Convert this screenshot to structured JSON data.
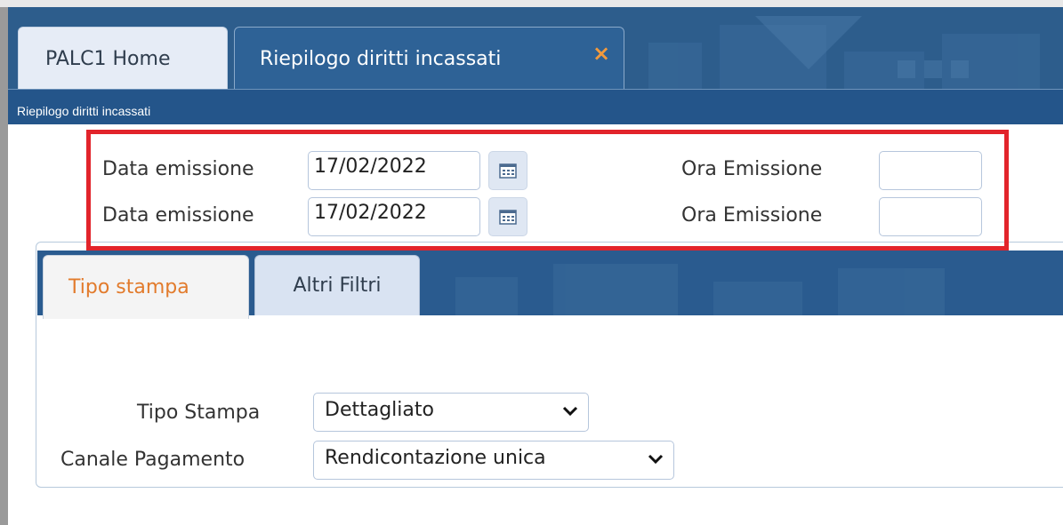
{
  "tabs": {
    "home_label": "PALC1 Home",
    "active_label": "Riepilogo diritti incassati",
    "close_glyph": "×"
  },
  "subtitle": "Riepilogo diritti incassati",
  "form": {
    "row1": {
      "date_label": "Data emissione",
      "date_value": "17/02/2022",
      "time_label": "Ora Emissione",
      "time_value": ""
    },
    "row2": {
      "date_label": "Data emissione",
      "date_value": "17/02/2022",
      "time_label": "Ora Emissione",
      "time_value": ""
    }
  },
  "filter_tabs": {
    "tab1": "Tipo stampa",
    "tab2": "Altri Filtri"
  },
  "filters": {
    "tipo_stampa_label": "Tipo Stampa",
    "tipo_stampa_value": "Dettagliato",
    "canale_label": "Canale Pagamento",
    "canale_value": "Rendicontazione unica"
  },
  "colors": {
    "header_blue": "#2d5d8c",
    "active_tab": "#2e6296",
    "accent_orange": "#e27b2c",
    "highlight_red": "#e2242b"
  },
  "icons": [
    "calendar-icon",
    "close-icon",
    "chevron-down-icon"
  ]
}
